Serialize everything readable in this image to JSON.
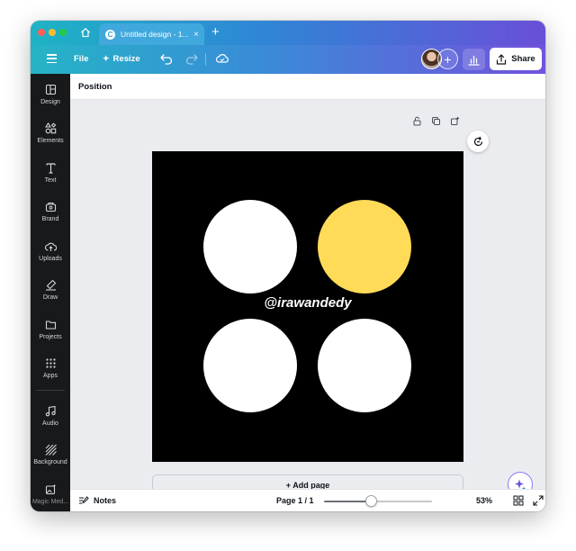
{
  "browser": {
    "tab_title": "Untitled design - 1...",
    "tab_favicon": "C",
    "tab_close": "×",
    "new_tab": "+"
  },
  "toolbar": {
    "file_label": "File",
    "resize_label": "Resize",
    "share_label": "Share",
    "add_collaborator": "+"
  },
  "sidebar": {
    "items": [
      {
        "label": "Design",
        "icon": "design-icon"
      },
      {
        "label": "Elements",
        "icon": "elements-icon"
      },
      {
        "label": "Text",
        "icon": "text-icon"
      },
      {
        "label": "Brand",
        "icon": "brand-icon"
      },
      {
        "label": "Uploads",
        "icon": "uploads-icon"
      },
      {
        "label": "Draw",
        "icon": "draw-icon"
      },
      {
        "label": "Projects",
        "icon": "projects-icon"
      },
      {
        "label": "Apps",
        "icon": "apps-icon"
      },
      {
        "label": "Audio",
        "icon": "audio-icon"
      },
      {
        "label": "Background",
        "icon": "background-icon"
      },
      {
        "label": "Magic Med...",
        "icon": "magic-media-icon"
      }
    ]
  },
  "context_bar": {
    "position_label": "Position"
  },
  "design": {
    "handle_text": "@irawandedy",
    "background_color": "#000000",
    "circle_colors": [
      "#ffffff",
      "#ffdb58",
      "#ffffff",
      "#ffffff"
    ]
  },
  "canvas": {
    "add_page_label": "+ Add page"
  },
  "footer": {
    "notes_label": "Notes",
    "page_indicator": "Page 1 / 1",
    "zoom_percent": "53%",
    "zoom_level": 0.44
  },
  "colors": {
    "accent_teal": "#1eb3c4",
    "accent_purple": "#6a4fd8",
    "highlight_yellow": "#ffdb58"
  }
}
